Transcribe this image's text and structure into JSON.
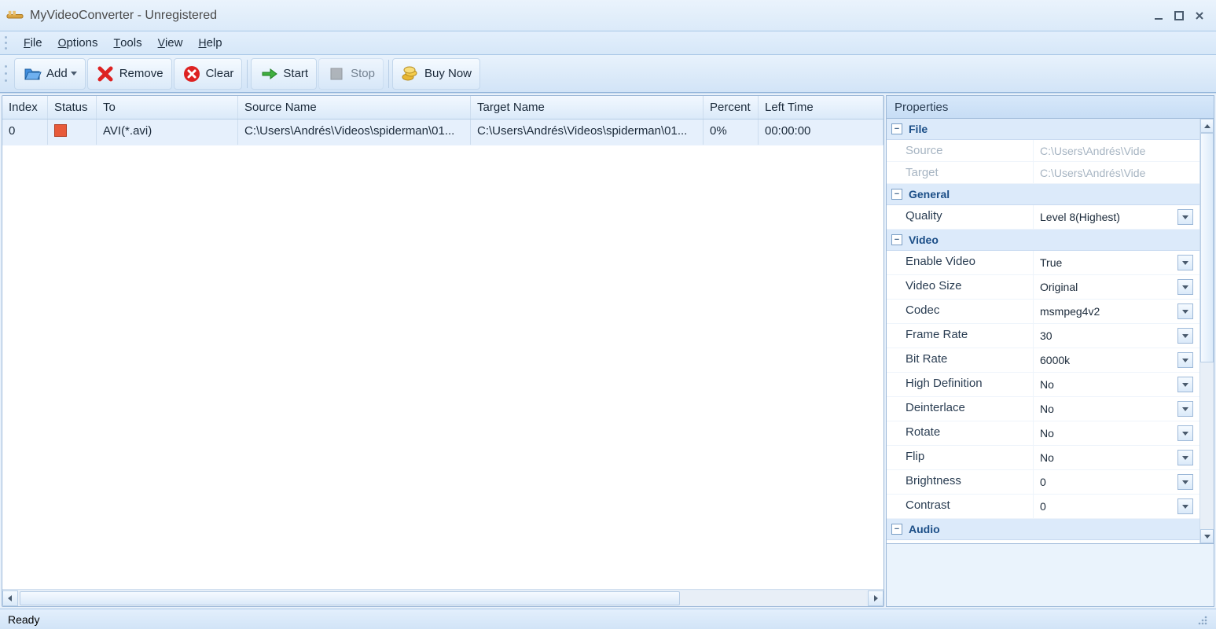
{
  "window": {
    "title": "MyVideoConverter - Unregistered"
  },
  "menu": {
    "file": "File",
    "options": "Options",
    "tools": "Tools",
    "view": "View",
    "help": "Help"
  },
  "toolbar": {
    "add": "Add",
    "remove": "Remove",
    "clear": "Clear",
    "start": "Start",
    "stop": "Stop",
    "buy": "Buy Now"
  },
  "columns": {
    "index": "Index",
    "status": "Status",
    "to": "To",
    "source": "Source Name",
    "target": "Target Name",
    "percent": "Percent",
    "left": "Left Time"
  },
  "rows": [
    {
      "index": "0",
      "to": "AVI(*.avi)",
      "source": "C:\\Users\\Andrés\\Videos\\spiderman\\01...",
      "target": "C:\\Users\\Andrés\\Videos\\spiderman\\01...",
      "percent": "0%",
      "left": "00:00:00"
    }
  ],
  "properties": {
    "title": "Properties",
    "file": {
      "label": "File",
      "source_label": "Source",
      "source_value": "C:\\Users\\Andrés\\Vide",
      "target_label": "Target",
      "target_value": "C:\\Users\\Andrés\\Vide"
    },
    "general": {
      "label": "General",
      "quality_label": "Quality",
      "quality_value": "Level 8(Highest)"
    },
    "video": {
      "label": "Video",
      "enable_label": "Enable Video",
      "enable_value": "True",
      "size_label": "Video Size",
      "size_value": "Original",
      "codec_label": "Codec",
      "codec_value": "msmpeg4v2",
      "framerate_label": "Frame Rate",
      "framerate_value": "30",
      "bitrate_label": "Bit Rate",
      "bitrate_value": "6000k",
      "hd_label": "High Definition",
      "hd_value": "No",
      "deint_label": "Deinterlace",
      "deint_value": "No",
      "rotate_label": "Rotate",
      "rotate_value": "No",
      "flip_label": "Flip",
      "flip_value": "No",
      "bright_label": "Brightness",
      "bright_value": "0",
      "contrast_label": "Contrast",
      "contrast_value": "0"
    },
    "audio": {
      "label": "Audio"
    }
  },
  "status": {
    "text": "Ready"
  }
}
